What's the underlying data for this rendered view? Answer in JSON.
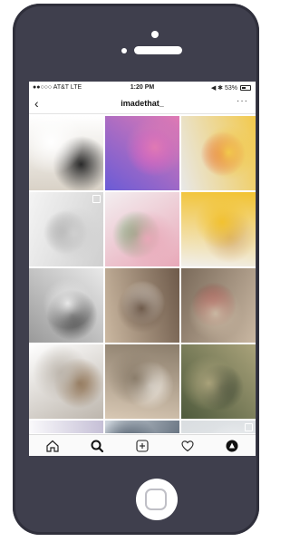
{
  "status_bar": {
    "carrier": "●●○○○ AT&T  LTE",
    "time": "1:20 PM",
    "right": "◀ ✱ 53%",
    "battery_level": 0.53
  },
  "nav": {
    "back_icon": "chevron-left-icon",
    "title": "imadethat_",
    "more_label": "···"
  },
  "grid": {
    "tiles": [
      {
        "name": "paper-model-person",
        "palette": [
          "#d9d2c7",
          "#ffffff",
          "#2a2a2a"
        ]
      },
      {
        "name": "purple-blob-render",
        "palette": [
          "#6a5bd6",
          "#e07ab3",
          "#b84fd1"
        ]
      },
      {
        "name": "cube-clusters-model",
        "palette": [
          "#e8e8e8",
          "#f2c94c",
          "#e04b4b"
        ]
      },
      {
        "name": "circular-site-plan",
        "palette": [
          "#f4f4f4",
          "#cfcfcf",
          "#9e9e9e"
        ],
        "multi": true
      },
      {
        "name": "pink-pavilion-render",
        "palette": [
          "#f3eef0",
          "#e8a8b8",
          "#6aa66a"
        ]
      },
      {
        "name": "yellow-paper-model",
        "palette": [
          "#f1efec",
          "#f2c230",
          "#d6b07a"
        ]
      },
      {
        "name": "person-with-model",
        "palette": [
          "#9a9a9a",
          "#e8e8e8",
          "#222222"
        ]
      },
      {
        "name": "exhibition-room",
        "palette": [
          "#cbb8a1",
          "#6e5a4a",
          "#eeeae4"
        ]
      },
      {
        "name": "crowd-at-gallery",
        "palette": [
          "#7a6a5a",
          "#c9b7a2",
          "#a23a3a"
        ]
      },
      {
        "name": "circular-section-drawing",
        "palette": [
          "#ffffff",
          "#bdb6ad",
          "#8a6b4a"
        ]
      },
      {
        "name": "model-table-display",
        "palette": [
          "#d8c8b4",
          "#8b7d6b",
          "#f4f0ea"
        ]
      },
      {
        "name": "aerial-city-model",
        "palette": [
          "#4e5a3c",
          "#a9a27a",
          "#2f3a2a"
        ]
      },
      {
        "name": "circle-render-bottom",
        "palette": [
          "#ffffff",
          "#c5bfd6",
          "#e8a0a0"
        ]
      },
      {
        "name": "people-in-hall",
        "palette": [
          "#cfd6dd",
          "#3c4a5a",
          "#9aa3ad"
        ]
      },
      {
        "name": "white-panels",
        "palette": [
          "#d9dde0",
          "#f0f2f4",
          "#b8bec4"
        ],
        "multi": true
      }
    ]
  },
  "tabbar": {
    "tabs": [
      {
        "name": "home-icon"
      },
      {
        "name": "search-icon"
      },
      {
        "name": "add-post-icon"
      },
      {
        "name": "heart-icon"
      },
      {
        "name": "profile-icon"
      }
    ]
  }
}
